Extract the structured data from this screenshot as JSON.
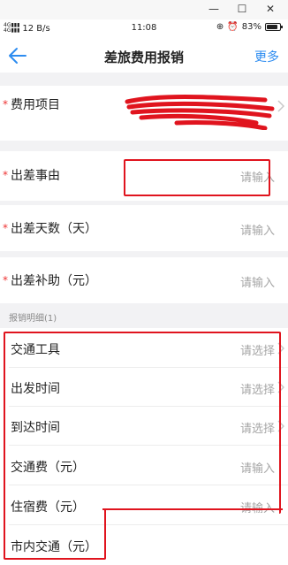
{
  "statusbar": {
    "network": "12 B/s",
    "time": "11:08",
    "battery": "83%",
    "battery_level": 0.83
  },
  "navbar": {
    "title": "差旅费用报销",
    "more": "更多"
  },
  "form": {
    "expense_item_label": "费用项目",
    "trip_reason_label": "出差事由",
    "trip_reason_placeholder": "请输入",
    "trip_days_label": "出差天数（天）",
    "trip_days_placeholder": "请输入",
    "trip_allowance_label": "出差补助（元）",
    "trip_allowance_placeholder": "请输入",
    "section_title": "报销明细(1)",
    "transport_label": "交通工具",
    "transport_placeholder": "请选择",
    "depart_time_label": "出发时间",
    "depart_time_placeholder": "请选择",
    "arrive_time_label": "到达时间",
    "arrive_time_placeholder": "请选择",
    "transport_fee_label": "交通费（元）",
    "transport_fee_placeholder": "请输入",
    "lodging_fee_label": "住宿费（元）",
    "lodging_fee_placeholder": "请输入",
    "city_transport_label": "市内交通（元）",
    "required_mark": "*"
  },
  "colors": {
    "accent": "#2d8cf0",
    "required": "#e33333",
    "annotation": "#e0141e"
  }
}
